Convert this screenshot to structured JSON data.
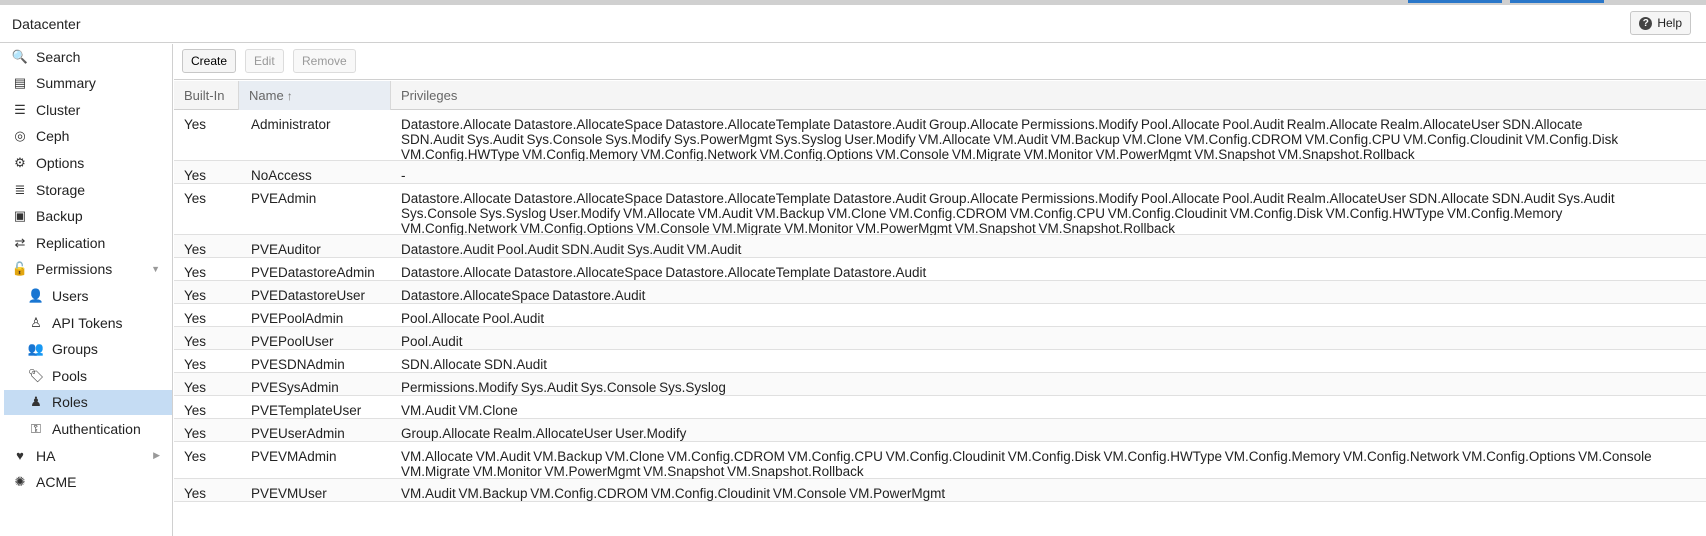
{
  "header": {
    "title": "Datacenter",
    "help_label": "Help"
  },
  "sidebar": {
    "items": [
      {
        "label": "Search",
        "icon": "search-icon",
        "name": "sidebar-item-search",
        "glyph": "🔍"
      },
      {
        "label": "Summary",
        "icon": "book-icon",
        "name": "sidebar-item-summary",
        "glyph": "▤"
      },
      {
        "label": "Cluster",
        "icon": "server-icon",
        "name": "sidebar-item-cluster",
        "glyph": "☰"
      },
      {
        "label": "Ceph",
        "icon": "ceph-icon",
        "name": "sidebar-item-ceph",
        "glyph": "◎"
      },
      {
        "label": "Options",
        "icon": "gear-icon",
        "name": "sidebar-item-options",
        "glyph": "⚙"
      },
      {
        "label": "Storage",
        "icon": "database-icon",
        "name": "sidebar-item-storage",
        "glyph": "≣"
      },
      {
        "label": "Backup",
        "icon": "floppy-icon",
        "name": "sidebar-item-backup",
        "glyph": "▣"
      },
      {
        "label": "Replication",
        "icon": "retweet-icon",
        "name": "sidebar-item-replication",
        "glyph": "⇄"
      },
      {
        "label": "Permissions",
        "icon": "unlock-icon",
        "name": "sidebar-item-permissions",
        "glyph": "🔓"
      },
      {
        "label": "Users",
        "icon": "user-icon",
        "name": "sidebar-item-users",
        "glyph": "👤"
      },
      {
        "label": "API Tokens",
        "icon": "user-outline-icon",
        "name": "sidebar-item-api-tokens",
        "glyph": "♙"
      },
      {
        "label": "Groups",
        "icon": "users-icon",
        "name": "sidebar-item-groups",
        "glyph": "👥"
      },
      {
        "label": "Pools",
        "icon": "tags-icon",
        "name": "sidebar-item-pools",
        "glyph": "🏷"
      },
      {
        "label": "Roles",
        "icon": "male-icon",
        "name": "sidebar-item-roles",
        "glyph": "♟"
      },
      {
        "label": "Authentication",
        "icon": "key-icon",
        "name": "sidebar-item-authentication",
        "glyph": "⚿"
      },
      {
        "label": "HA",
        "icon": "heartbeat-icon",
        "name": "sidebar-item-ha",
        "glyph": "♥"
      },
      {
        "label": "ACME",
        "icon": "certificate-icon",
        "name": "sidebar-item-acme",
        "glyph": "✺"
      }
    ]
  },
  "toolbar": {
    "create_label": "Create",
    "edit_label": "Edit",
    "remove_label": "Remove"
  },
  "table": {
    "columns": {
      "builtin": "Built-In",
      "name": "Name",
      "privileges": "Privileges",
      "sort_indicator": "↑"
    },
    "rows": [
      {
        "builtin": "Yes",
        "name": "Administrator",
        "privileges": [
          "Datastore.Allocate Datastore.AllocateSpace Datastore.AllocateTemplate Datastore.Audit Group.Allocate Permissions.Modify Pool.Allocate Pool.Audit Realm.Allocate Realm.AllocateUser SDN.Allocate",
          "SDN.Audit Sys.Audit Sys.Console Sys.Modify Sys.PowerMgmt Sys.Syslog User.Modify VM.Allocate VM.Audit VM.Backup VM.Clone VM.Config.CDROM VM.Config.CPU VM.Config.Cloudinit VM.Config.Disk",
          "VM.Config.HWType VM.Config.Memory VM.Config.Network VM.Config.Options VM.Console VM.Migrate VM.Monitor VM.PowerMgmt VM.Snapshot VM.Snapshot.Rollback"
        ]
      },
      {
        "builtin": "Yes",
        "name": "NoAccess",
        "privileges": [
          "-"
        ]
      },
      {
        "builtin": "Yes",
        "name": "PVEAdmin",
        "privileges": [
          "Datastore.Allocate Datastore.AllocateSpace Datastore.AllocateTemplate Datastore.Audit Group.Allocate Permissions.Modify Pool.Allocate Pool.Audit Realm.AllocateUser SDN.Allocate SDN.Audit Sys.Audit",
          "Sys.Console Sys.Syslog User.Modify VM.Allocate VM.Audit VM.Backup VM.Clone VM.Config.CDROM VM.Config.CPU VM.Config.Cloudinit VM.Config.Disk VM.Config.HWType VM.Config.Memory",
          "VM.Config.Network VM.Config.Options VM.Console VM.Migrate VM.Monitor VM.PowerMgmt VM.Snapshot VM.Snapshot.Rollback"
        ]
      },
      {
        "builtin": "Yes",
        "name": "PVEAuditor",
        "privileges": [
          "Datastore.Audit Pool.Audit SDN.Audit Sys.Audit VM.Audit"
        ]
      },
      {
        "builtin": "Yes",
        "name": "PVEDatastoreAdmin",
        "privileges": [
          "Datastore.Allocate Datastore.AllocateSpace Datastore.AllocateTemplate Datastore.Audit"
        ]
      },
      {
        "builtin": "Yes",
        "name": "PVEDatastoreUser",
        "privileges": [
          "Datastore.AllocateSpace Datastore.Audit"
        ]
      },
      {
        "builtin": "Yes",
        "name": "PVEPoolAdmin",
        "privileges": [
          "Pool.Allocate Pool.Audit"
        ]
      },
      {
        "builtin": "Yes",
        "name": "PVEPoolUser",
        "privileges": [
          "Pool.Audit"
        ]
      },
      {
        "builtin": "Yes",
        "name": "PVESDNAdmin",
        "privileges": [
          "SDN.Allocate SDN.Audit"
        ]
      },
      {
        "builtin": "Yes",
        "name": "PVESysAdmin",
        "privileges": [
          "Permissions.Modify Sys.Audit Sys.Console Sys.Syslog"
        ]
      },
      {
        "builtin": "Yes",
        "name": "PVETemplateUser",
        "privileges": [
          "VM.Audit VM.Clone"
        ]
      },
      {
        "builtin": "Yes",
        "name": "PVEUserAdmin",
        "privileges": [
          "Group.Allocate Realm.AllocateUser User.Modify"
        ]
      },
      {
        "builtin": "Yes",
        "name": "PVEVMAdmin",
        "privileges": [
          "VM.Allocate VM.Audit VM.Backup VM.Clone VM.Config.CDROM VM.Config.CPU VM.Config.Cloudinit VM.Config.Disk VM.Config.HWType VM.Config.Memory VM.Config.Network VM.Config.Options VM.Console",
          "VM.Migrate VM.Monitor VM.PowerMgmt VM.Snapshot VM.Snapshot.Rollback"
        ]
      },
      {
        "builtin": "Yes",
        "name": "PVEVMUser",
        "privileges": [
          "VM.Audit VM.Backup VM.Config.CDROM VM.Config.Cloudinit VM.Console VM.PowerMgmt"
        ]
      }
    ]
  },
  "colors": {
    "selected_bg": "#c5dcf3",
    "accent": "#2a77c9",
    "border": "#d0d0d0"
  }
}
